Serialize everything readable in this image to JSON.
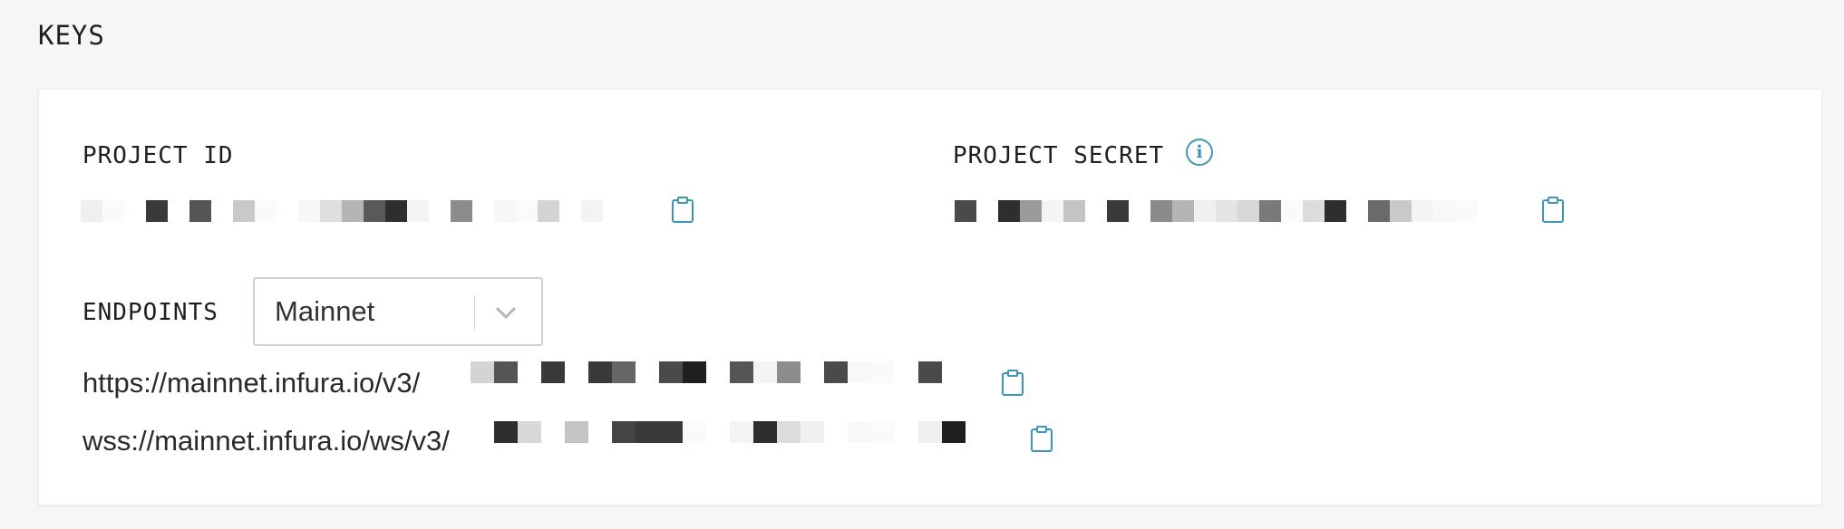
{
  "section": {
    "title": "KEYS"
  },
  "keys": {
    "project_id": {
      "label": "PROJECT ID"
    },
    "project_secret": {
      "label": "PROJECT SECRET"
    }
  },
  "endpoints": {
    "label": "ENDPOINTS",
    "network_select": {
      "selected": "Mainnet"
    },
    "https_prefix": "https://mainnet.infura.io/v3/",
    "wss_prefix": "wss://mainnet.infura.io/ws/v3/"
  },
  "icons": {
    "info": "info-icon",
    "copy": "clipboard-icon",
    "dropdown": "chevron-down-icon"
  },
  "colors": {
    "accent": "#3d96b8",
    "background": "#f6f6f6",
    "card": "#ffffff"
  }
}
